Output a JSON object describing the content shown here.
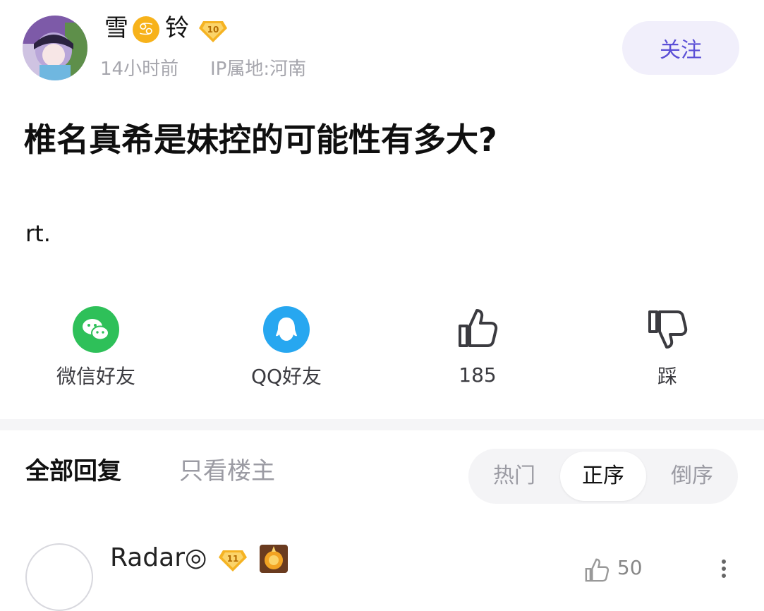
{
  "post": {
    "author": {
      "name_part1": "雪",
      "zodiac_glyph": "♋",
      "name_part2": "铃",
      "level": "10",
      "time": "14小时前",
      "ip": "IP属地:河南"
    },
    "follow_label": "关注",
    "title": "椎名真希是妹控的可能性有多大?",
    "body": "rt."
  },
  "actions": {
    "wechat": "微信好友",
    "qq": "QQ好友",
    "like_count": "185",
    "dislike": "踩"
  },
  "replies": {
    "tab_all": "全部回复",
    "tab_op_only": "只看楼主",
    "sort_hot": "热门",
    "sort_asc": "正序",
    "sort_desc": "倒序",
    "active_sort": "正序"
  },
  "first_comment": {
    "name": "Radar◎",
    "level": "11",
    "like_count": "50"
  },
  "colors": {
    "accent": "#5b4fd6",
    "wechat_green": "#2ec059",
    "qq_blue": "#27a7f0",
    "badge_gold": "#f5b323"
  }
}
